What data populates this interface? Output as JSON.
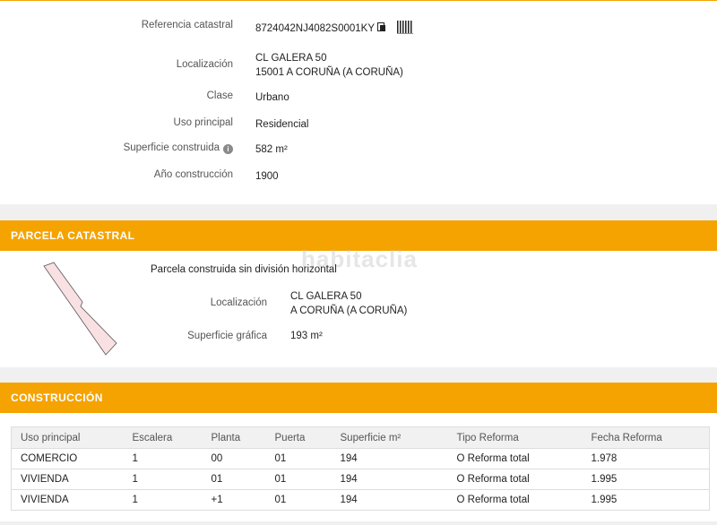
{
  "info": {
    "ref_label": "Referencia catastral",
    "ref_value": "8724042NJ4082S0001KY",
    "loc_label": "Localización",
    "loc_line1": "CL GALERA 50",
    "loc_line2": "15001 A CORUÑA (A CORUÑA)",
    "clase_label": "Clase",
    "clase_value": "Urbano",
    "uso_label": "Uso principal",
    "uso_value": "Residencial",
    "sup_label": "Superficie construida",
    "sup_value": "582 m²",
    "anio_label": "Año construcción",
    "anio_value": "1900",
    "info_icon_glyph": "i"
  },
  "parcela": {
    "header": "PARCELA CATASTRAL",
    "watermark": "habitaclia",
    "title": "Parcela construida sin división horizontal",
    "loc_label": "Localización",
    "loc_line1": "CL GALERA 50",
    "loc_line2": "A CORUÑA (A CORUÑA)",
    "sup_label": "Superficie gráfica",
    "sup_value": "193 m²",
    "shape_fill": "#f9e0e2",
    "shape_stroke": "#555555"
  },
  "construccion": {
    "header": "CONSTRUCCIÓN",
    "columns": [
      "Uso principal",
      "Escalera",
      "Planta",
      "Puerta",
      "Superficie m²",
      "Tipo Reforma",
      "Fecha Reforma"
    ],
    "rows": [
      [
        "COMERCIO",
        "1",
        "00",
        "01",
        "194",
        "O Reforma total",
        "1.978"
      ],
      [
        "VIVIENDA",
        "1",
        "01",
        "01",
        "194",
        "O Reforma total",
        "1.995"
      ],
      [
        "VIVIENDA",
        "1",
        "+1",
        "01",
        "194",
        "O Reforma total",
        "1.995"
      ]
    ]
  },
  "colors": {
    "accent": "#f5a300"
  }
}
